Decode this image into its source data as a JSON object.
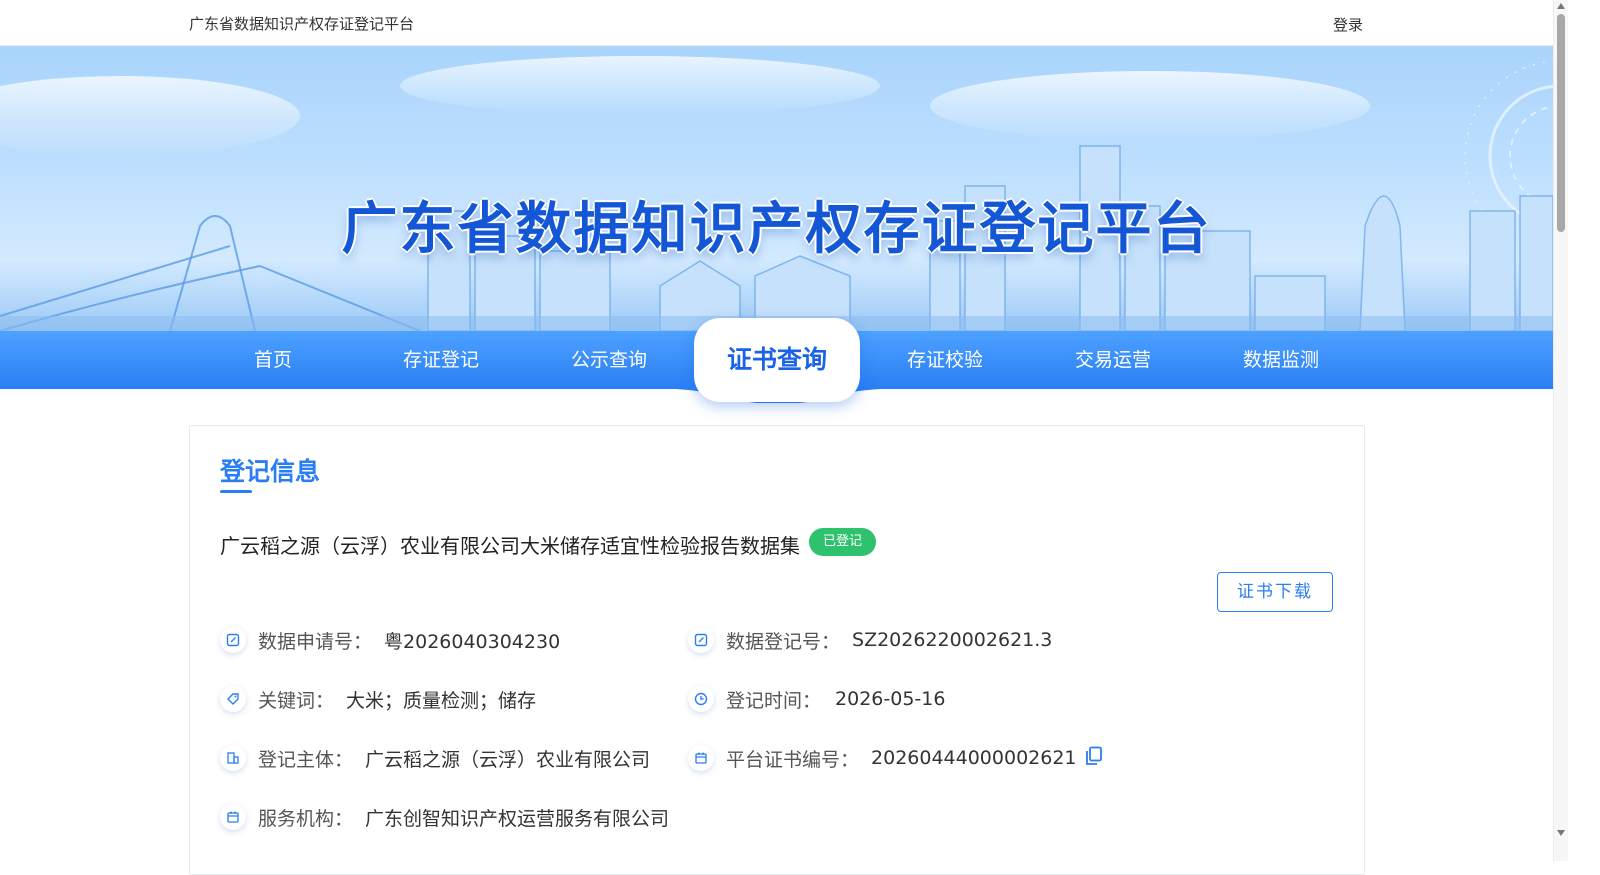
{
  "header": {
    "site_name": "广东省数据知识产权存证登记平台",
    "login_label": "登录"
  },
  "banner": {
    "title": "广东省数据知识产权存证登记平台"
  },
  "nav": {
    "items": [
      {
        "label": "首页"
      },
      {
        "label": "存证登记"
      },
      {
        "label": "公示查询"
      },
      {
        "label": "证书查询",
        "active": true
      },
      {
        "label": "存证校验"
      },
      {
        "label": "交易运营"
      },
      {
        "label": "数据监测"
      }
    ]
  },
  "section": {
    "title": "登记信息"
  },
  "record": {
    "dataset_name": "广云稻之源（云浮）农业有限公司大米储存适宜性检验报告数据集",
    "status": "已登记",
    "download_label": "证书下载",
    "fields": {
      "application_no": {
        "label": "数据申请号：",
        "value": "粤2026040304230",
        "icon": "edit-icon"
      },
      "registration_no": {
        "label": "数据登记号：",
        "value": "SZ2026220002621.3",
        "icon": "edit-icon"
      },
      "keywords": {
        "label": "关键词：",
        "value": "大米；质量检测；储存",
        "icon": "tag-icon"
      },
      "registration_time": {
        "label": "登记时间：",
        "value": "2026-05-16",
        "icon": "clock-icon"
      },
      "registrant": {
        "label": "登记主体：",
        "value": "广云稻之源（云浮）农业有限公司",
        "icon": "building-icon"
      },
      "certificate_no": {
        "label": "平台证书编号：",
        "value": "20260444000002621",
        "icon": "calendar-icon"
      },
      "service_agency": {
        "label": "服务机构：",
        "value": "广东创智知识产权运营服务有限公司",
        "icon": "calendar-icon"
      }
    }
  },
  "colors": {
    "accent": "#2a7ef4",
    "status_green": "#2ec26e",
    "title_blue": "#1457d6"
  }
}
